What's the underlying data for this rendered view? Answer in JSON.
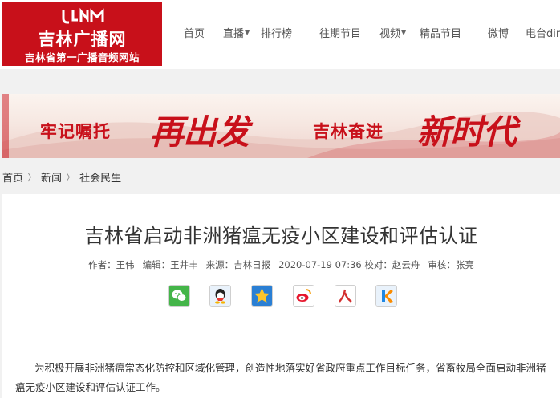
{
  "site": {
    "name": "吉林广播网",
    "slogan": "吉林省第一广播音频网站"
  },
  "nav": [
    "首页",
    "直播",
    "排行榜",
    "往期节目",
    "视频",
    "精品节目",
    "微博",
    "电台direct"
  ],
  "banner": {
    "part1": "牢记嘱托",
    "part2": "再出发",
    "part3": "吉林奋进",
    "part4": "新时代"
  },
  "breadcrumb": [
    "首页",
    "新闻",
    "社会民生"
  ],
  "article": {
    "title": "吉林省启动非洲猪瘟无疫小区建设和评估认证",
    "meta": {
      "author": "作者：王伟",
      "editor": "编辑：王井丰",
      "source": "来源：吉林日报",
      "datetime": "2020-07-19 07:36",
      "proofreader": "校对：赵云舟",
      "reviewer": "审核：张亮"
    },
    "share_icons": [
      "wechat-icon",
      "qq-icon",
      "qzone-icon",
      "weibo-icon",
      "renren-icon",
      "kaixin-icon"
    ],
    "body": "为积极开展非洲猪瘟常态化防控和区域化管理，创造性地落实好省政府重点工作目标任务，省畜牧局全面启动非洲猪瘟无疫小区建设和评估认证工作。"
  },
  "colors": {
    "brand_red": "#c8101a",
    "page_bg": "#f1f1f1"
  }
}
